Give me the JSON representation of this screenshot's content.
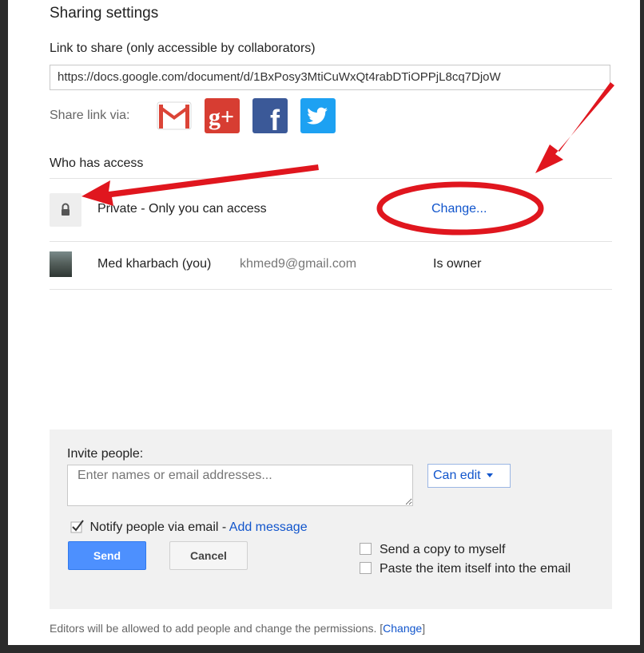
{
  "dialog": {
    "title": "Sharing settings",
    "link_label": "Link to share (only accessible by collaborators)",
    "link_url": "https://docs.google.com/document/d/1BxPosy3MtiCuWxQt4rabDTiOPPjL8cq7DjoW",
    "share_via_label": "Share link via:",
    "share_icons": [
      "gmail-icon",
      "google-plus-icon",
      "facebook-icon",
      "twitter-icon"
    ],
    "share_icon_labels": {
      "gplus": "g+",
      "facebook": "f"
    },
    "who_has_access": "Who has access",
    "access": {
      "text": "Private - Only you can access",
      "change": "Change..."
    },
    "owner": {
      "name": "Med kharbach (you)",
      "email": "khmed9@gmail.com",
      "role": "Is owner"
    }
  },
  "invite": {
    "label": "Invite people:",
    "placeholder": "Enter names or email addresses...",
    "permission": "Can edit",
    "notify_label": "Notify people via email",
    "notify_separator": " - ",
    "notify_checked": true,
    "add_message": "Add message",
    "send": "Send",
    "cancel": "Cancel",
    "copy_to_self": "Send a copy to myself",
    "paste_item": "Paste the item itself into the email"
  },
  "footer": {
    "text": "Editors will be allowed to add people and change the permissions.",
    "bracket_open": " [",
    "change": "Change",
    "bracket_close": "]"
  },
  "colors": {
    "link": "#1155cc",
    "send_button": "#4d90fe",
    "annotation": "#e0161e",
    "gmail": "#db4437",
    "google_plus": "#d73d32",
    "facebook": "#3b5998",
    "twitter": "#1da1f2"
  }
}
